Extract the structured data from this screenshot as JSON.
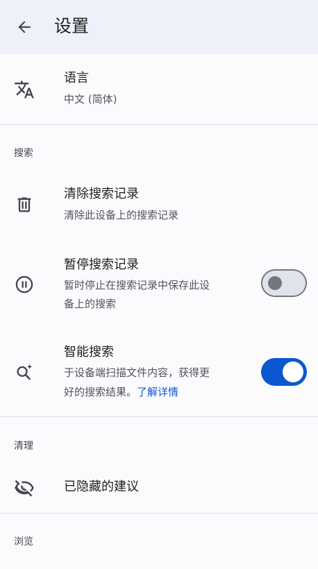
{
  "header": {
    "title": "设置",
    "back_icon": "arrow-back-icon"
  },
  "language": {
    "icon": "translate-icon",
    "title": "语言",
    "value": "中文 (简体)"
  },
  "sections": {
    "search": "搜索",
    "clean": "清理",
    "browse": "浏览"
  },
  "clear_history": {
    "icon": "delete-icon",
    "title": "清除搜索记录",
    "subtitle": "清除此设备上的搜索记录"
  },
  "pause_history": {
    "icon": "pause-circle-icon",
    "title": "暂停搜索记录",
    "subtitle_line1": "暂时停止在搜索记录中保存此设",
    "subtitle_line2": "备上的搜索",
    "enabled": false
  },
  "smart_search": {
    "icon": "smart-search-icon",
    "title": "智能搜索",
    "subtitle_line1": "于设备端扫描文件内容，获得更",
    "subtitle_line2": "好的搜索结果。",
    "link": "了解详情",
    "enabled": true
  },
  "hidden_suggestions": {
    "icon": "visibility-off-icon",
    "title": "已隐藏的建议"
  },
  "colors": {
    "accent": "#0b57d0",
    "header_bg": "#eef1f9"
  }
}
